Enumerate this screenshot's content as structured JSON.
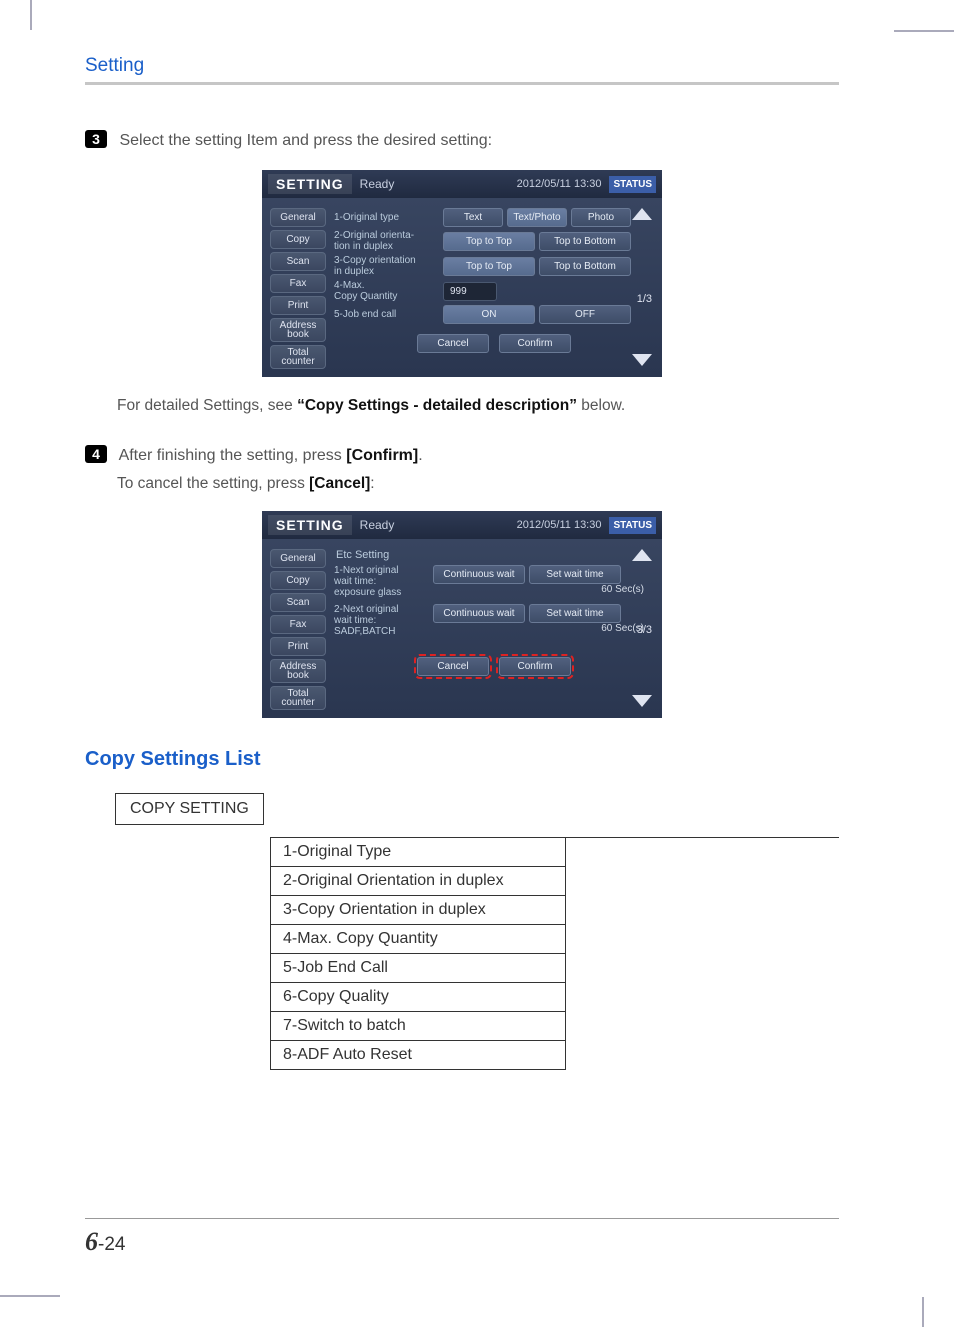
{
  "section": "Setting",
  "step3": {
    "num": "3",
    "text": "Select the setting Item and press the desired setting:"
  },
  "shot1": {
    "title": "SETTING",
    "status": "Ready",
    "date": "2012/05/11 13:30",
    "statusbtn": "STATUS",
    "tabs": [
      "General",
      "Copy",
      "Scan",
      "Fax",
      "Print",
      "Address book",
      "Total counter"
    ],
    "rows": [
      {
        "label": "1-Original type",
        "opts": [
          "Text",
          "Text/Photo",
          "Photo"
        ],
        "sel": 1
      },
      {
        "label": "2-Original orienta-\n   tion in duplex",
        "opts": [
          "Top to Top",
          "Top to Bottom"
        ],
        "sel": 0
      },
      {
        "label": "3-Copy orientation\n   in duplex",
        "opts": [
          "Top to Top",
          "Top to Bottom"
        ],
        "sel": 0
      },
      {
        "label": "4-Max.\n   Copy Quantity",
        "value": "999"
      },
      {
        "label": "5-Job end call",
        "opts": [
          "ON",
          "OFF"
        ],
        "sel": 0
      }
    ],
    "page": "1/3",
    "cancel": "Cancel",
    "confirm": "Confirm"
  },
  "detail_pre": "For detailed Settings, see  ",
  "detail_q": "“Copy Settings - detailed description”",
  "detail_post": " below.",
  "step4": {
    "num": "4",
    "p1a": "After finishing the setting, press ",
    "p1b": "[Confirm]",
    "p1c": ".",
    "p2a": "To cancel the setting, press ",
    "p2b": "[Cancel]",
    "p2c": ":"
  },
  "shot2": {
    "title": "SETTING",
    "status": "Ready",
    "date": "2012/05/11 13:30",
    "statusbtn": "STATUS",
    "tabs": [
      "General",
      "Copy",
      "Scan",
      "Fax",
      "Print",
      "Address book",
      "Total counter"
    ],
    "header": "Etc Setting",
    "rows": [
      {
        "label": "1-Next original\n  wait time:\n  exposure glass",
        "opts": [
          "Continuous wait",
          "Set wait time"
        ],
        "aux": "60  Sec(s)"
      },
      {
        "label": "2-Next original\n  wait time:\n  SADF,BATCH",
        "opts": [
          "Continuous wait",
          "Set wait time"
        ],
        "aux": "60  Sec(s)"
      }
    ],
    "page": "3/3",
    "cancel": "Cancel",
    "confirm": "Confirm"
  },
  "listhead": "Copy Settings List",
  "tree": {
    "root": "COPY SETTING",
    "items": [
      "1-Original  Type",
      "2-Original Orientation in duplex",
      "3-Copy Orientation in duplex",
      "4-Max. Copy Quantity",
      "5-Job End Call",
      "6-Copy Quality",
      "7-Switch to batch",
      "8-ADF Auto Reset"
    ]
  },
  "pagenum": {
    "chapter": "6",
    "sep": "-",
    "page": "24"
  }
}
